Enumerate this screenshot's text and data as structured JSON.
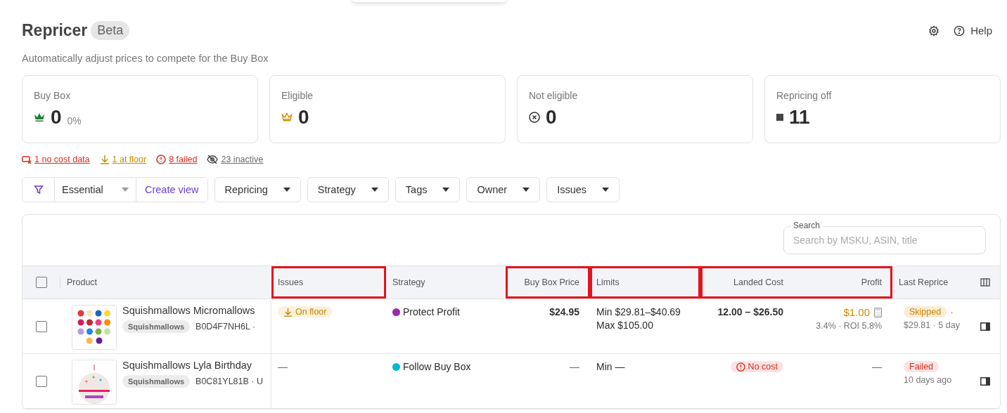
{
  "header": {
    "title": "Repricer",
    "badge": "Beta",
    "subtitle": "Automatically adjust prices to compete for the Buy Box",
    "actions": [
      {
        "kind": "settings"
      },
      {
        "kind": "help",
        "label": "Help"
      }
    ]
  },
  "stats": [
    {
      "kind": "buy_box",
      "label": "Buy Box",
      "value": "0",
      "percent": "0%"
    },
    {
      "kind": "eligible",
      "label": "Eligible",
      "value": "0"
    },
    {
      "kind": "not_eligible",
      "label": "Not eligible",
      "value": "0"
    },
    {
      "kind": "off",
      "label": "Repricing off",
      "value": "11"
    }
  ],
  "issue_links": [
    {
      "kind": "no_cost",
      "label": "1 no cost data",
      "color": "#d92d20"
    },
    {
      "kind": "at_floor",
      "label": "1 at floor",
      "color": "#d18a00"
    },
    {
      "kind": "failed",
      "label": "8 failed",
      "color": "#d92d20"
    },
    {
      "kind": "inactive",
      "label": "23 inactive",
      "color": "#6b6b6b"
    }
  ],
  "filters": {
    "view": "Essential",
    "create_view": "Create view",
    "dropdowns": [
      "Repricing",
      "Strategy",
      "Tags",
      "Owner",
      "Issues"
    ]
  },
  "table": {
    "search": {
      "label": "Search",
      "placeholder": "Search by MSKU, ASIN, title"
    },
    "select_all": {
      "checked": false
    },
    "columns": [
      {
        "label": "Product",
        "kind": "text",
        "highlighted": false
      },
      {
        "label": "Issues",
        "kind": "text",
        "highlighted": true,
        "joins_next": false
      },
      {
        "label": "Strategy",
        "kind": "text",
        "highlighted": false
      },
      {
        "label": "Buy Box Price",
        "kind": "numeric",
        "highlighted": true,
        "joins_next": false
      },
      {
        "label": "Limits",
        "kind": "text",
        "highlighted": true,
        "joins_next": false
      },
      {
        "label": "Landed Cost",
        "kind": "numeric",
        "highlighted": true,
        "joins_next": true
      },
      {
        "label": "Profit",
        "kind": "numeric",
        "highlighted": true,
        "joins_next": false
      },
      {
        "label": "Last Reprice",
        "kind": "text",
        "highlighted": false
      }
    ],
    "rows": [
      {
        "checked": false,
        "image": {
          "kind": "grid"
        },
        "title": "Squishmallows Micromallows",
        "tag": "Squishmallows",
        "asin": "B0D4F7NH6L ·",
        "issue": {
          "kind": "on_floor",
          "label": "On floor"
        },
        "strategy": {
          "label": "Protect Profit",
          "color": "#9c27b0"
        },
        "buy_box_price": "$24.95",
        "limits": [
          "Min $29.81–$40.69",
          "Max $105.00"
        ],
        "landed_cost": {
          "kind": "text",
          "text": "12.00 – $26.50"
        },
        "profit": {
          "kind": "value",
          "value": "$1.00",
          "detail": "3.4% · ROI 5.8%"
        },
        "last_reprice": {
          "status": {
            "kind": "skipped",
            "label": "Skipped"
          },
          "suffix": "·",
          "detail": "$29.81 · 5 day"
        }
      },
      {
        "checked": false,
        "image": {
          "kind": "cake"
        },
        "title": "Squishmallows Lyla Birthday",
        "tag": "Squishmallows",
        "asin": "B0C81YL81B · U",
        "issue": {
          "kind": "none",
          "label": "—"
        },
        "strategy": {
          "label": "Follow Buy Box",
          "color": "#00b8d4"
        },
        "buy_box_price": "—",
        "limits": [
          "Min —"
        ],
        "landed_cost": {
          "kind": "badge",
          "text": "No cost"
        },
        "profit": {
          "kind": "none",
          "value": "—"
        },
        "last_reprice": {
          "status": {
            "kind": "failed",
            "label": "Failed"
          },
          "detail": "10 days ago"
        }
      }
    ]
  }
}
